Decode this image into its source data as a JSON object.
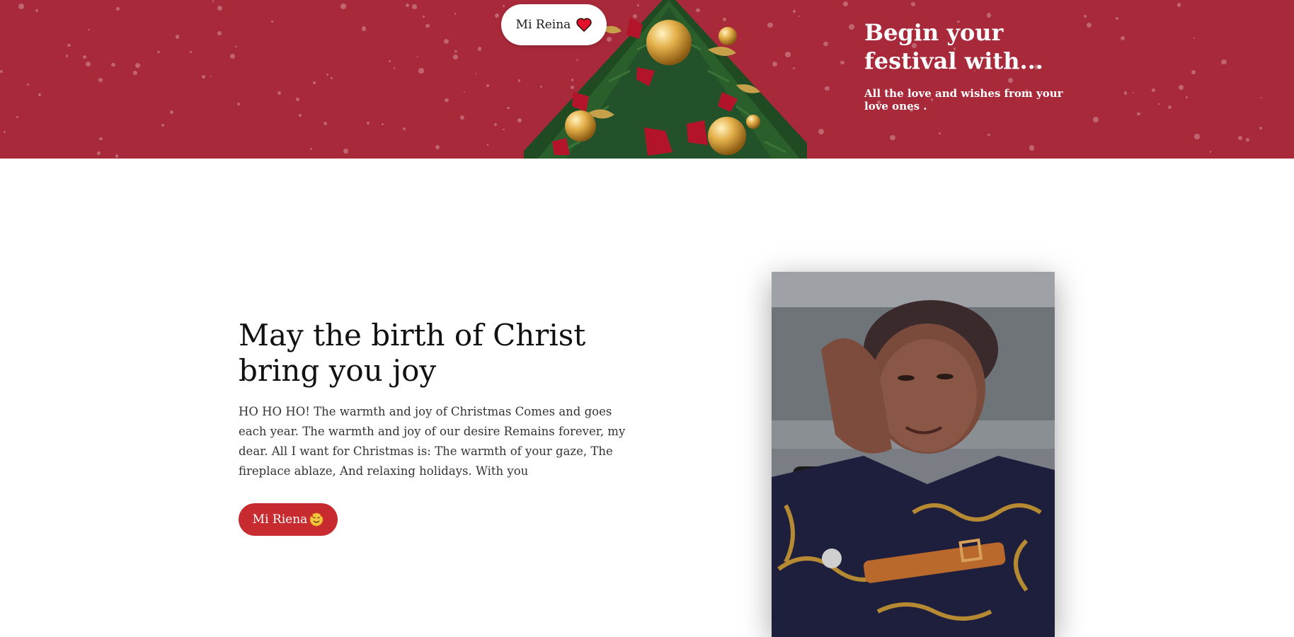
{
  "hero": {
    "pill_label": "Mi Reina",
    "pill_icon": "heart-icon",
    "title": "Begin your\nfestival with...",
    "subtitle": "All the love and wishes from your love ones .",
    "background_color": "#a8293a"
  },
  "main": {
    "heading": "May the birth of Christ bring you joy",
    "body": "HO HO HO! The warmth and joy of Christmas Comes and goes each year. The warmth and joy of our desire Remains forever, my dear. All I want for Christmas is: The warmth of your gaze, The fireplace ablaze, And relaxing holidays. With you",
    "button_label": "Mi Riena",
    "button_icon": "smiling-face-with-hearts-icon",
    "button_color": "#c72a2f"
  },
  "photo": {
    "alt": "portrait photo"
  }
}
